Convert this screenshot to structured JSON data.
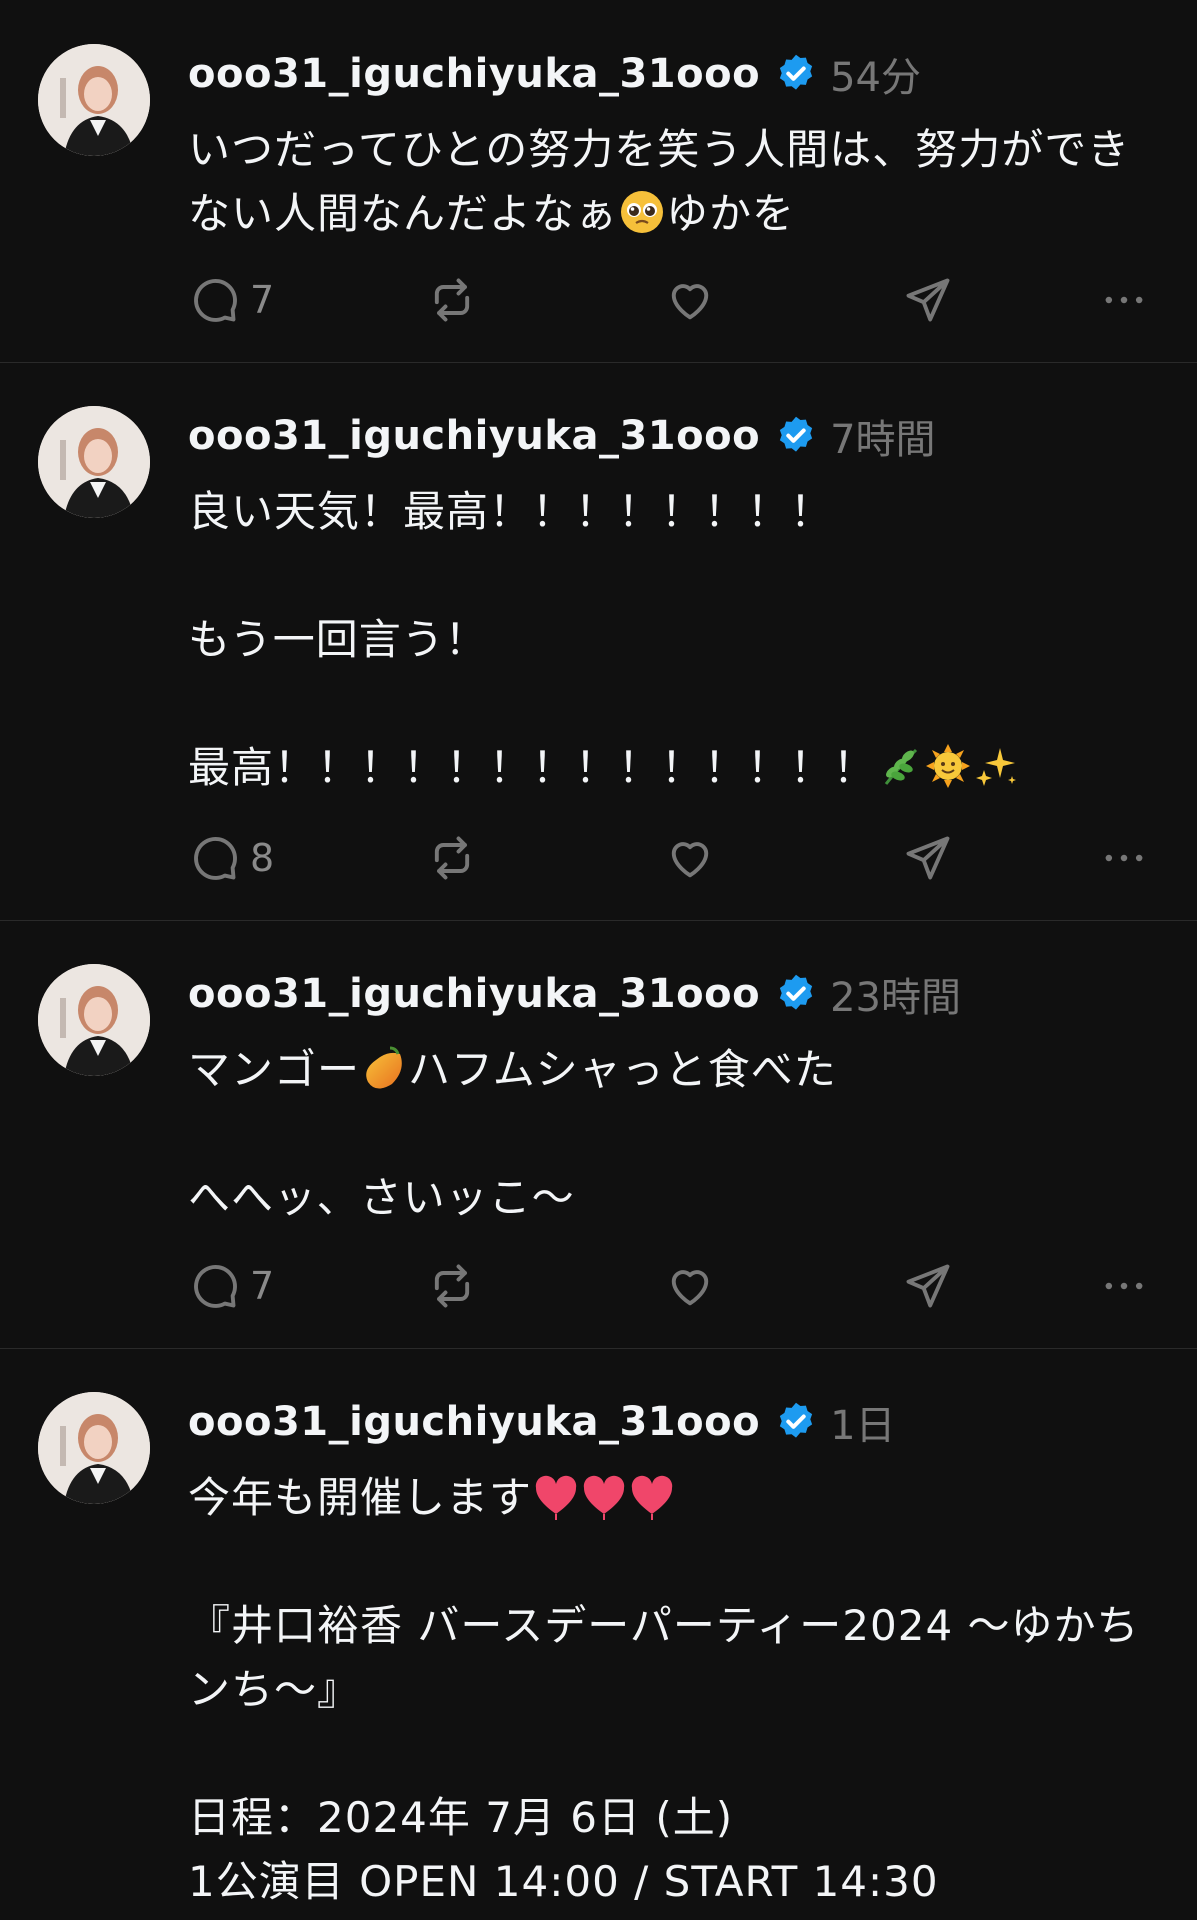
{
  "colors": {
    "background": "#101010",
    "text": "#f3f5f7",
    "muted": "#777777",
    "verified": "#1d9bf0",
    "divider": "#2a2a2a"
  },
  "posts": [
    {
      "username": "ooo31_iguchiyuka_31ooo",
      "time": "54分",
      "body_html": "いつだってひとの努力を笑う人間は、努力ができない人間なんだよなぁ[pleading]ゆかを",
      "lines": [
        "いつだってひとの努力を笑う人間は、努力ができ",
        "ない人間なんだよなぁ",
        "ゆかを"
      ],
      "reply_count": "7"
    },
    {
      "username": "ooo31_iguchiyuka_31ooo",
      "time": "7時間",
      "lines": [
        "良い天気！最高！！！！！！！！",
        "",
        "もう一回言う！",
        "",
        "最高！！！！！！！！！！！！！！"
      ],
      "reply_count": "8"
    },
    {
      "username": "ooo31_iguchiyuka_31ooo",
      "time": "23時間",
      "lines": [
        "マンゴー",
        "ハフムシャっと食べた",
        "",
        "へへッ、さいッこ〜"
      ],
      "reply_count": "7"
    },
    {
      "username": "ooo31_iguchiyuka_31ooo",
      "time": "1日",
      "lines": [
        "今年も開催します",
        "",
        "『井口裕香 バースデーパーティー2024 〜ゆかち",
        "ンち〜』",
        "",
        "日程：2024年 7月 6日 (土)",
        "1公演目 OPEN 14:00 / START 14:30"
      ]
    }
  ],
  "icons": [
    "verified-badge-icon",
    "reply-icon",
    "repost-icon",
    "like-icon",
    "share-icon",
    "more-icon",
    "pleading-face-emoji",
    "herb-emoji",
    "sun-face-emoji",
    "sparkles-emoji",
    "mango-emoji",
    "heart-emoji"
  ]
}
